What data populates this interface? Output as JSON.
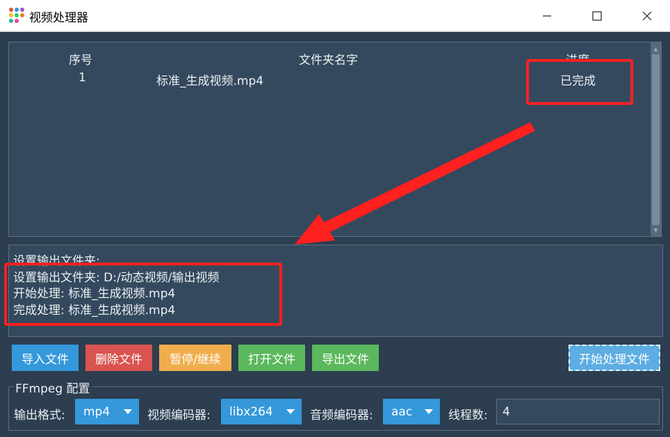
{
  "window": {
    "title": "视频处理器",
    "minimize_glyph": "—",
    "maximize_glyph": "☐",
    "close_glyph": "✕"
  },
  "table": {
    "headers": [
      "序号",
      "文件夹名字",
      "进度"
    ],
    "rows": [
      {
        "index": "1",
        "name": "标准_生成视频.mp4",
        "progress": "已完成"
      }
    ]
  },
  "log": {
    "lines": [
      "设置输出文件夹:",
      "设置输出文件夹: D:/动态视频/输出视频",
      "开始处理: 标准_生成视频.mp4",
      "完成处理: 标准_生成视频.mp4"
    ]
  },
  "buttons": {
    "import": "导入文件",
    "delete": "删除文件",
    "pause": "暂停/继续",
    "open": "打开文件",
    "export": "导出文件",
    "start": "开始处理文件"
  },
  "config": {
    "group_title": "FFmpeg 配置",
    "output_format_label": "输出格式:",
    "output_format_value": "mp4",
    "video_codec_label": "视频编码器:",
    "video_codec_value": "libx264",
    "audio_codec_label": "音频编码器:",
    "audio_codec_value": "aac",
    "threads_label": "线程数:",
    "threads_value": "4"
  },
  "colors": {
    "background": "#2c3e50",
    "panel": "#34495e",
    "btn_import": "#3498db",
    "btn_delete": "#d9534f",
    "btn_pause": "#f0ad4e",
    "btn_open": "#5cb85c",
    "btn_export": "#5cb85c",
    "btn_start": "#5dade2",
    "annotation": "#ff2020"
  }
}
